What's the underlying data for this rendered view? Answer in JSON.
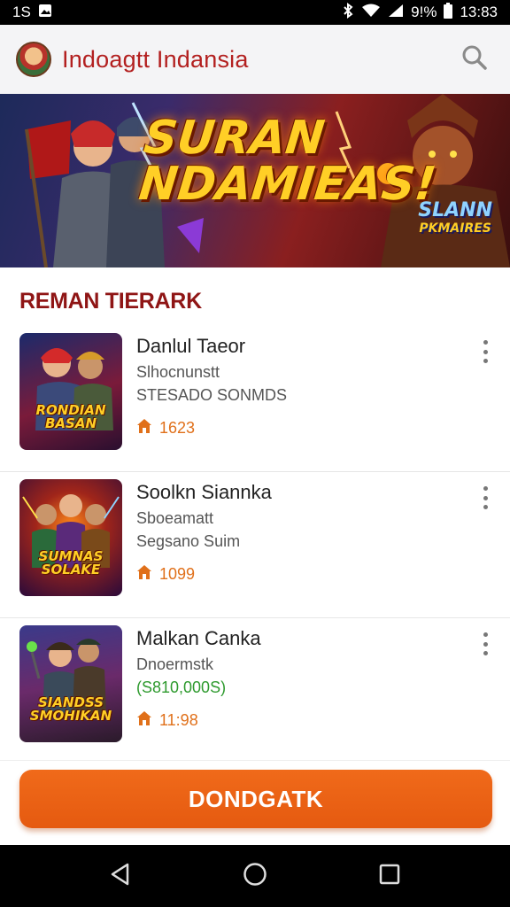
{
  "status_bar": {
    "left_text": "1S",
    "battery": "9!%",
    "time": "13:83"
  },
  "app_bar": {
    "title": "Indoagtt Indansia"
  },
  "banner": {
    "title": "SURAN NDAMIEAS!",
    "badge_title": "SLANN",
    "badge_sub": "PKMAIRES"
  },
  "section": {
    "title": "REMAN TIERARK"
  },
  "games": [
    {
      "name": "Danlul Taeor",
      "sub1": "Slhocnunstt",
      "sub2": "STESADO SONMDS",
      "price": "1623",
      "thumb_text": "RONDIAN BASAN"
    },
    {
      "name": "Soolkn Siannka",
      "sub1": "Sboeamatt",
      "sub2": "Segsano Suim",
      "price": "1099",
      "thumb_text": "SUMNAS SOLAKE"
    },
    {
      "name": "Malkan Canka",
      "sub1": "Dnoermstk",
      "sub2": "(S810,000S)",
      "price": "11:98",
      "thumb_text": "SIANDSS SMOHIKAN"
    }
  ],
  "cta": {
    "label": "DONDGATK"
  },
  "colors": {
    "accent": "#e55a10",
    "title_red": "#b32020",
    "section_red": "#8f1515",
    "price_orange": "#e0701a"
  }
}
